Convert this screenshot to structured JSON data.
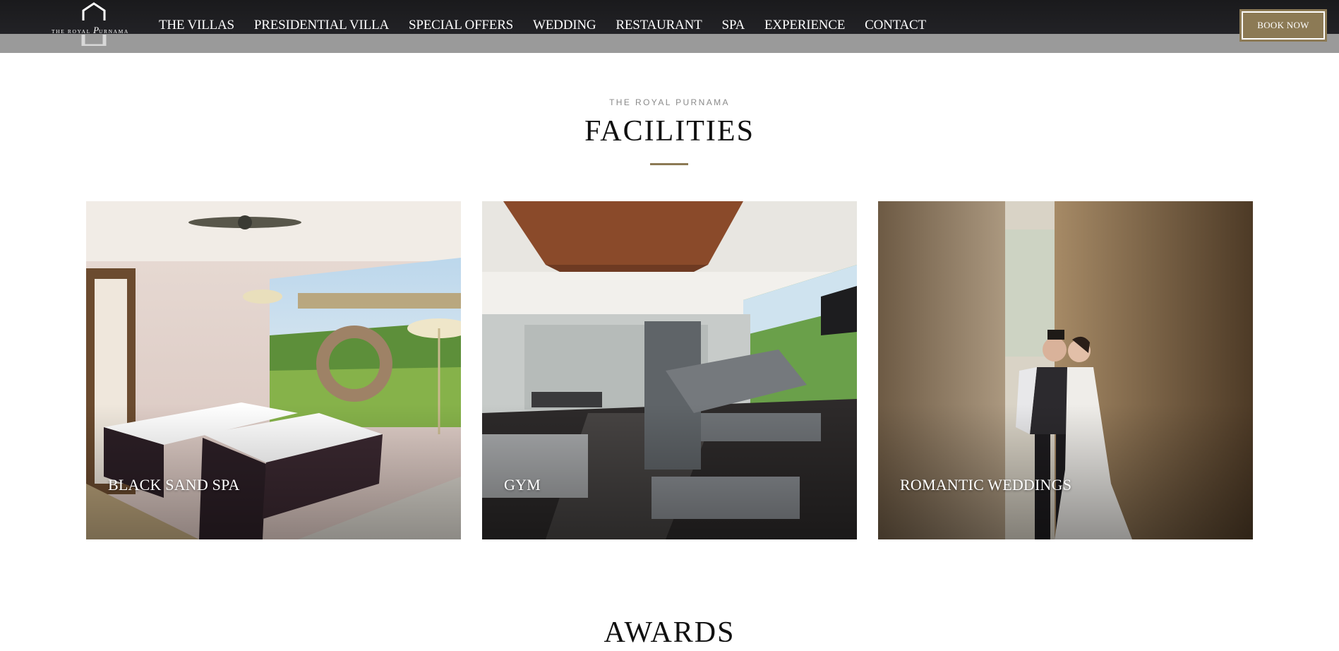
{
  "header": {
    "logo": {
      "text_small": "THE ROYAL",
      "text_p": "P",
      "text_rest": "URNAMA"
    },
    "nav": [
      {
        "label": "THE VILLAS"
      },
      {
        "label": "PRESIDENTIAL VILLA"
      },
      {
        "label": "SPECIAL OFFERS"
      },
      {
        "label": "WEDDING"
      },
      {
        "label": "RESTAURANT"
      },
      {
        "label": "SPA"
      },
      {
        "label": "EXPERIENCE"
      },
      {
        "label": "CONTACT"
      }
    ],
    "book_now": "BOOK NOW"
  },
  "facilities": {
    "eyebrow": "THE ROYAL PURNAMA",
    "title": "FACILITIES",
    "cards": [
      {
        "label": "BLACK SAND SPA",
        "icon": "spa-photo"
      },
      {
        "label": "GYM",
        "icon": "gym-photo"
      },
      {
        "label": "ROMANTIC WEDDINGS",
        "icon": "wedding-photo"
      }
    ]
  },
  "awards": {
    "title": "AWARDS"
  },
  "colors": {
    "accent": "#8c7a55",
    "header_bg": "#1a1a1c",
    "strip": "#9a9a9a",
    "text": "#111111"
  }
}
